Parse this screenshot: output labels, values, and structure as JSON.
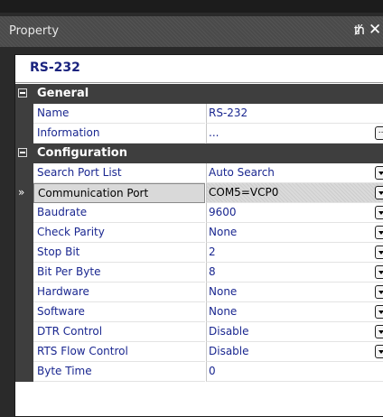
{
  "window": {
    "title": "Property"
  },
  "object_box": {
    "value": "RS-232"
  },
  "categories": [
    {
      "label": "General",
      "properties": [
        {
          "name": "Name",
          "value": "RS-232",
          "editor": "none"
        },
        {
          "name": "Information",
          "value": "...",
          "editor": "ellipsis"
        }
      ]
    },
    {
      "label": "Configuration",
      "properties": [
        {
          "name": "Search Port List",
          "value": "Auto Search",
          "editor": "dropdown"
        },
        {
          "name": "Communication Port",
          "value": "COM5=VCP0",
          "editor": "dropdown",
          "selected": true
        },
        {
          "name": "Baudrate",
          "value": "9600",
          "editor": "dropdown"
        },
        {
          "name": "Check Parity",
          "value": "None",
          "editor": "dropdown"
        },
        {
          "name": "Stop Bit",
          "value": "2",
          "editor": "dropdown"
        },
        {
          "name": "Bit Per Byte",
          "value": "8",
          "editor": "dropdown"
        },
        {
          "name": "Hardware",
          "value": "None",
          "editor": "dropdown"
        },
        {
          "name": "Software",
          "value": "None",
          "editor": "dropdown"
        },
        {
          "name": "DTR Control",
          "value": "Disable",
          "editor": "dropdown"
        },
        {
          "name": "RTS Flow Control",
          "value": "Disable",
          "editor": "dropdown"
        },
        {
          "name": "Byte Time",
          "value": "0",
          "editor": "none"
        }
      ]
    }
  ],
  "icons": {
    "pin": "pin-icon",
    "close": "close-icon",
    "collapse": "minus-box-icon",
    "selection": "double-chevron-right-icon"
  },
  "colors": {
    "title_bg": "#4a4a4a",
    "category_bg": "#3e3e3e",
    "property_text": "#1a2790",
    "object_text": "#1a237e",
    "selected_row": "#d9d9d9"
  }
}
